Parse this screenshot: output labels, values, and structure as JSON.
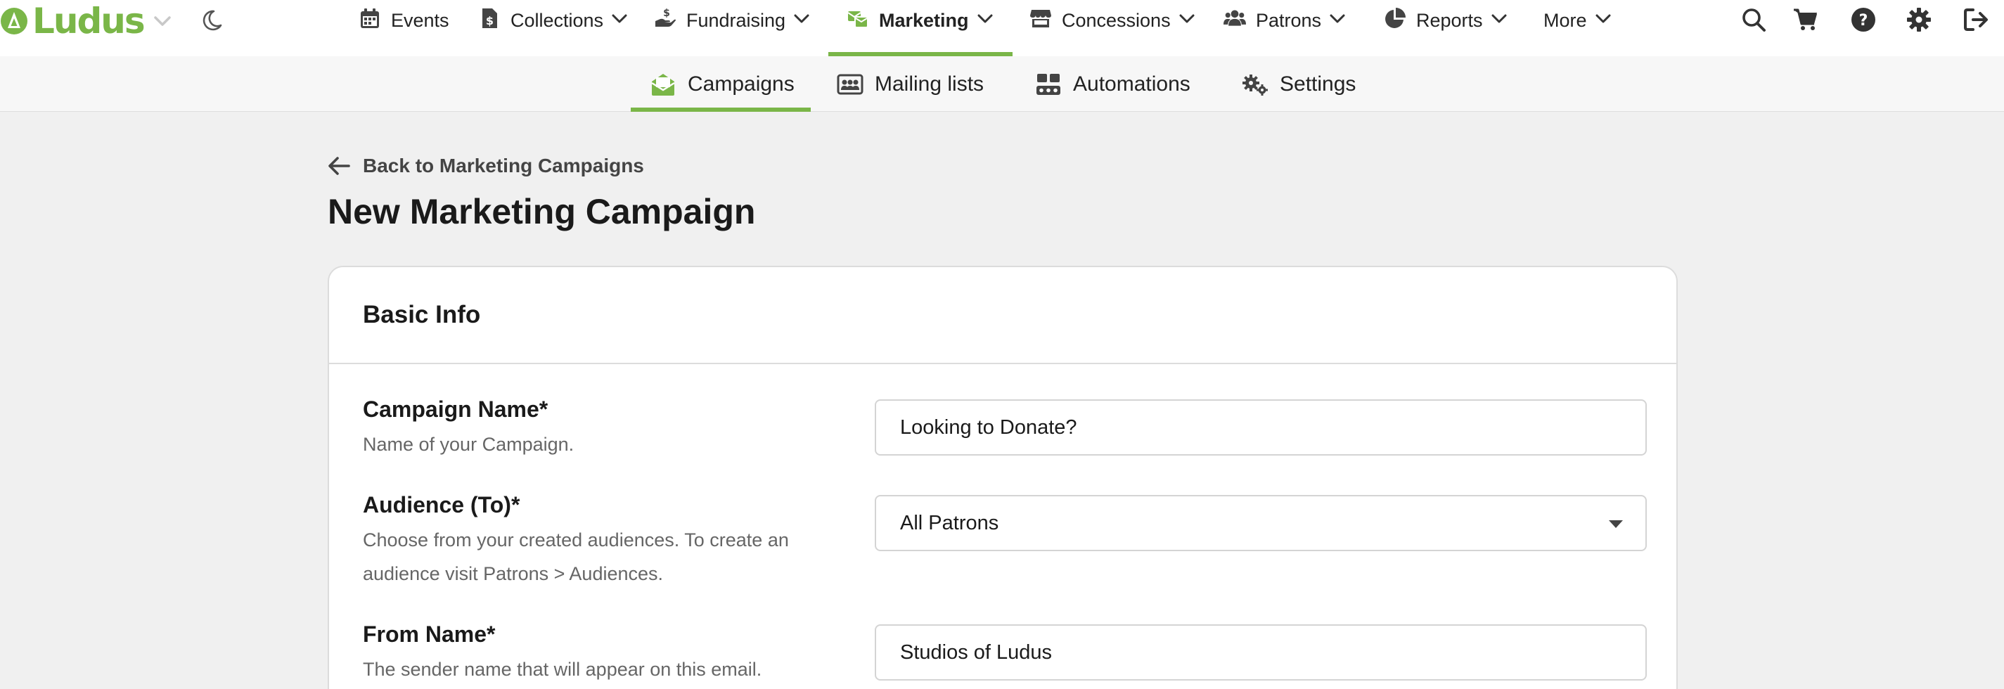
{
  "app": {
    "logo_text": "Ludus"
  },
  "colors": {
    "brand": "#7ab648",
    "page_bg": "#f0f0f0"
  },
  "topnav": {
    "items": [
      {
        "label": "Events",
        "icon": "calendar-icon",
        "dropdown": false
      },
      {
        "label": "Collections",
        "icon": "dollar-file-icon",
        "dropdown": true
      },
      {
        "label": "Fundraising",
        "icon": "hand-dollar-icon",
        "dropdown": true
      },
      {
        "label": "Marketing",
        "icon": "mail-bulk-icon",
        "dropdown": true,
        "active": true
      },
      {
        "label": "Concessions",
        "icon": "store-icon",
        "dropdown": true
      },
      {
        "label": "Patrons",
        "icon": "users-icon",
        "dropdown": true
      },
      {
        "label": "Reports",
        "icon": "pie-chart-icon",
        "dropdown": true
      },
      {
        "label": "More",
        "icon": "",
        "dropdown": true
      }
    ],
    "utilities": [
      "search-icon",
      "cart-icon",
      "help-icon",
      "gear-icon",
      "logout-icon"
    ]
  },
  "subnav": {
    "items": [
      {
        "label": "Campaigns",
        "icon": "envelope-open-icon",
        "active": true
      },
      {
        "label": "Mailing lists",
        "icon": "address-card-icon"
      },
      {
        "label": "Automations",
        "icon": "automation-icon"
      },
      {
        "label": "Settings",
        "icon": "gears-icon"
      }
    ]
  },
  "page": {
    "back_label": "Back to Marketing Campaigns",
    "title": "New Marketing Campaign"
  },
  "card": {
    "title": "Basic Info",
    "fields": [
      {
        "label": "Campaign Name*",
        "help": "Name of your Campaign.",
        "value": "Looking to Donate?",
        "type": "text"
      },
      {
        "label": "Audience (To)*",
        "help": "Choose from your created audiences. To create an audience visit Patrons > Audiences.",
        "value": "All Patrons",
        "type": "select"
      },
      {
        "label": "From Name*",
        "help": "The sender name that will appear on this email.",
        "value": "Studios of Ludus",
        "type": "text"
      }
    ]
  }
}
